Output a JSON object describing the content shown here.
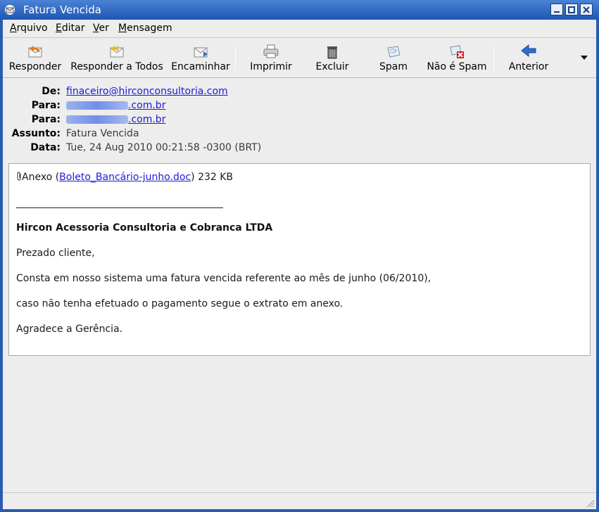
{
  "window": {
    "title": "Fatura Vencida"
  },
  "menubar": {
    "items": [
      {
        "label": "Arquivo",
        "mnemonic": "A",
        "rest": "rquivo"
      },
      {
        "label": "Editar",
        "mnemonic": "E",
        "rest": "ditar"
      },
      {
        "label": "Ver",
        "mnemonic": "V",
        "rest": "er"
      },
      {
        "label": "Mensagem",
        "mnemonic": "M",
        "rest": "ensagem"
      }
    ]
  },
  "toolbar": {
    "reply": "Responder",
    "reply_all": "Responder a Todos",
    "forward": "Encaminhar",
    "print": "Imprimir",
    "delete": "Excluir",
    "spam": "Spam",
    "not_spam": "Não é Spam",
    "previous": "Anterior"
  },
  "headers": {
    "from_label": "De:",
    "from_value": "finaceiro@hirconconsultoria.com",
    "to_label": "Para:",
    "to1_suffix": ".com.br",
    "to2_suffix": ".com.br",
    "subject_label": "Assunto:",
    "subject_value": "Fatura Vencida",
    "date_label": "Data:",
    "date_value": "Tue, 24 Aug 2010 00:21:58 -0300 (BRT)"
  },
  "message": {
    "attachment_prefix": "Anexo (",
    "attachment_name": "Boleto_Bancário-junho.doc",
    "attachment_suffix": ") 232 KB",
    "company": "Hircon Acessoria Consultoria e Cobranca LTDA",
    "greeting": "Prezado cliente,",
    "line1": "Consta em nosso sistema uma fatura vencida referente ao mês de junho (06/2010),",
    "line2": "caso não tenha efetuado o pagamento segue o extrato em anexo.",
    "closing": "Agradece a Gerência."
  },
  "colors": {
    "titlebar": "#2a5bb0",
    "link": "#1a1ad8",
    "background": "#ededed"
  }
}
